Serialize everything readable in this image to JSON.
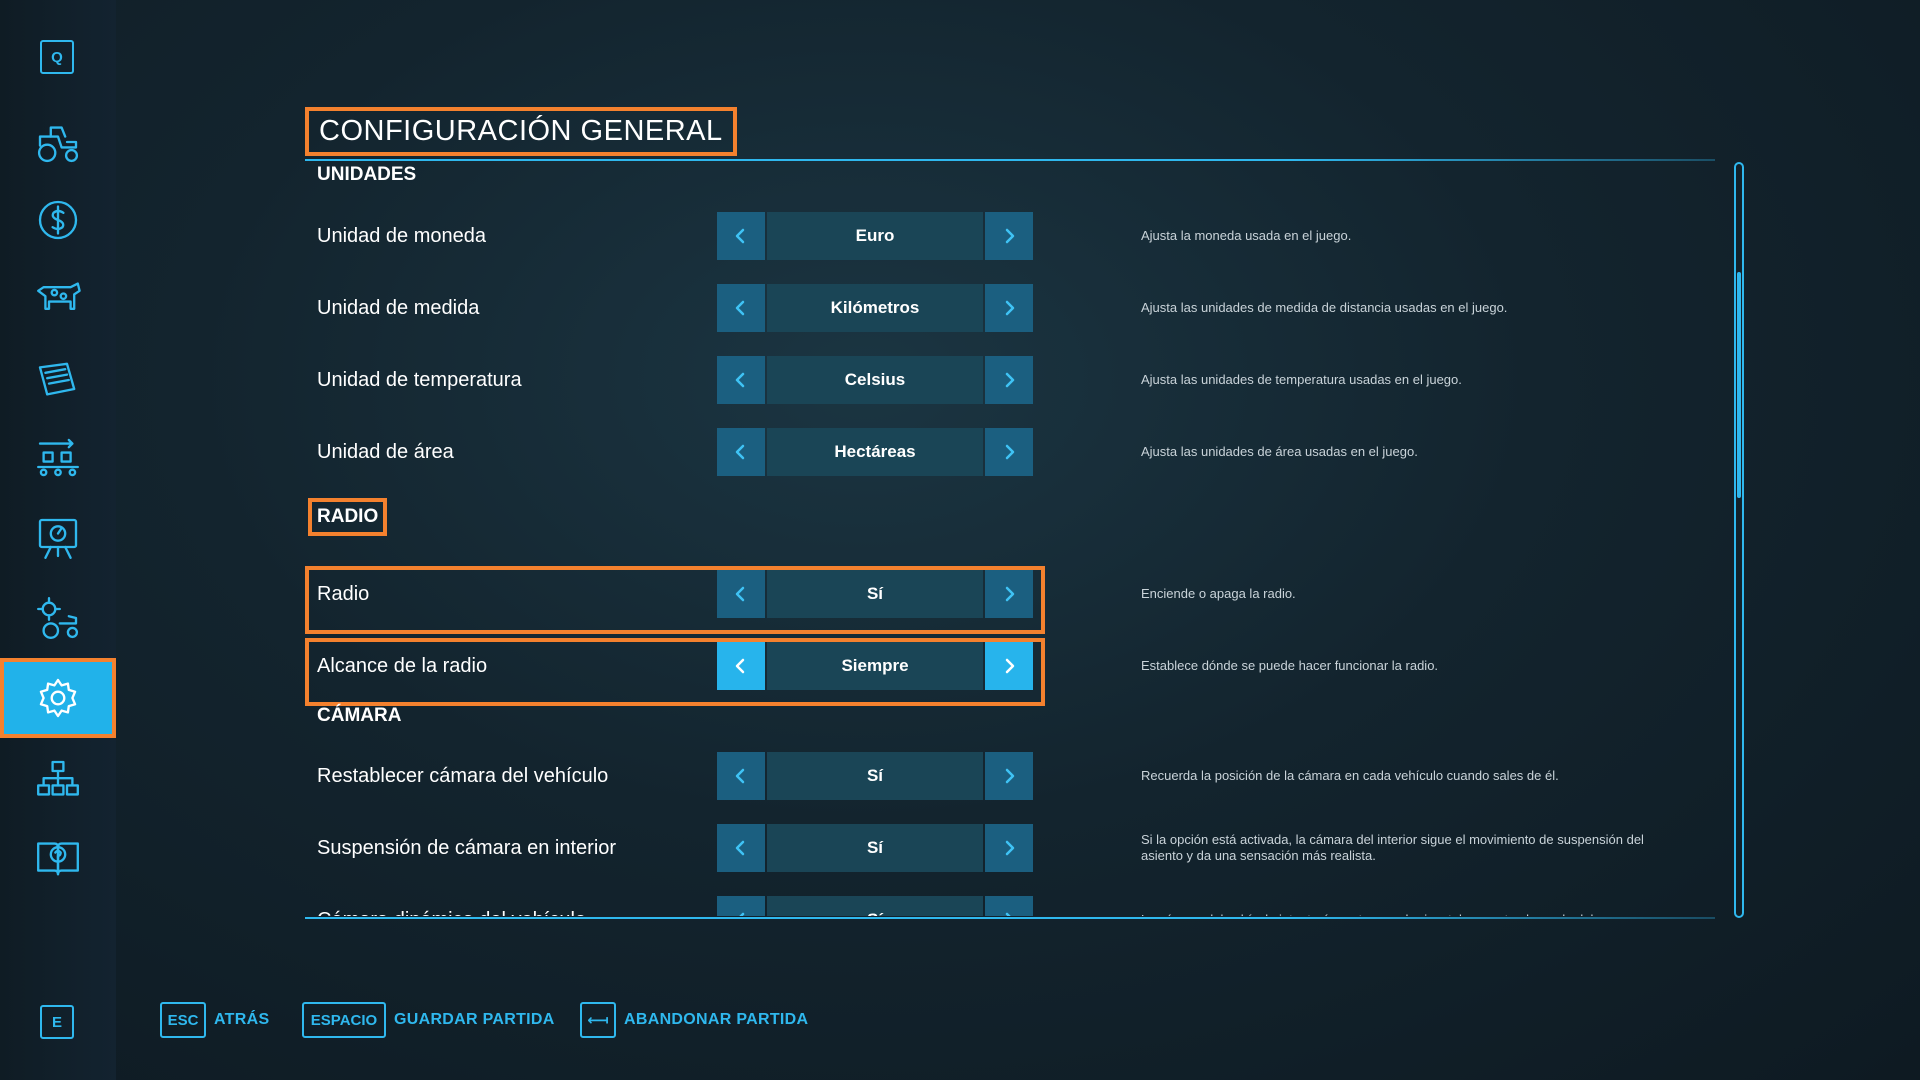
{
  "sidebar": {
    "top_key": "Q",
    "bottom_key": "E",
    "items": [
      {
        "icon": "tractor-icon"
      },
      {
        "icon": "dollar-icon"
      },
      {
        "icon": "cow-icon"
      },
      {
        "icon": "contracts-icon"
      },
      {
        "icon": "production-icon"
      },
      {
        "icon": "info-board-icon"
      },
      {
        "icon": "gear-tractor-icon"
      },
      {
        "icon": "gear-icon",
        "active": true
      },
      {
        "icon": "network-icon"
      },
      {
        "icon": "help-book-icon"
      }
    ]
  },
  "page": {
    "title": "CONFIGURACIÓN GENERAL"
  },
  "sections": {
    "unidades": "UNIDADES",
    "radio": "RADIO",
    "camara": "CÁMARA"
  },
  "rows": {
    "moneda": {
      "label": "Unidad de moneda",
      "value": "Euro",
      "desc": "Ajusta la moneda usada en el juego."
    },
    "medida": {
      "label": "Unidad de medida",
      "value": "Kilómetros",
      "desc": "Ajusta las unidades de medida de distancia usadas en el juego."
    },
    "temperatura": {
      "label": "Unidad de temperatura",
      "value": "Celsius",
      "desc": "Ajusta las unidades de temperatura usadas en el juego."
    },
    "area": {
      "label": "Unidad de área",
      "value": "Hectáreas",
      "desc": "Ajusta las unidades de área usadas en el juego."
    },
    "radio": {
      "label": "Radio",
      "value": "Sí",
      "desc": "Enciende o apaga la radio."
    },
    "alcance": {
      "label": "Alcance de la radio",
      "value": "Siempre",
      "desc": "Establece dónde se puede hacer funcionar la radio."
    },
    "restablecer": {
      "label": "Restablecer cámara del vehículo",
      "value": "Sí",
      "desc": "Recuerda la posición de la cámara en cada vehículo cuando sales de él."
    },
    "suspension": {
      "label": "Suspensión de cámara en interior",
      "value": "Sí",
      "desc": "Si la opción está activada, la cámara del interior sigue el movimiento de suspensión del asiento y da una sensación más realista."
    },
    "dinamica": {
      "label": "Cámara dinámica del vehículo",
      "value": "Sí",
      "desc": "La cámara del vehículo intentará mantenerse horizontal respecto al mundo del"
    }
  },
  "footer": {
    "back_key": "ESC",
    "back_label": "ATRÁS",
    "save_key": "ESPACIO",
    "save_label": "GUARDAR PARTIDA",
    "quit_key": "⟻",
    "quit_label": "ABANDONAR PARTIDA"
  },
  "colors": {
    "accent": "#2fb8ee",
    "highlight": "#f4812e",
    "background": "#13242e"
  }
}
